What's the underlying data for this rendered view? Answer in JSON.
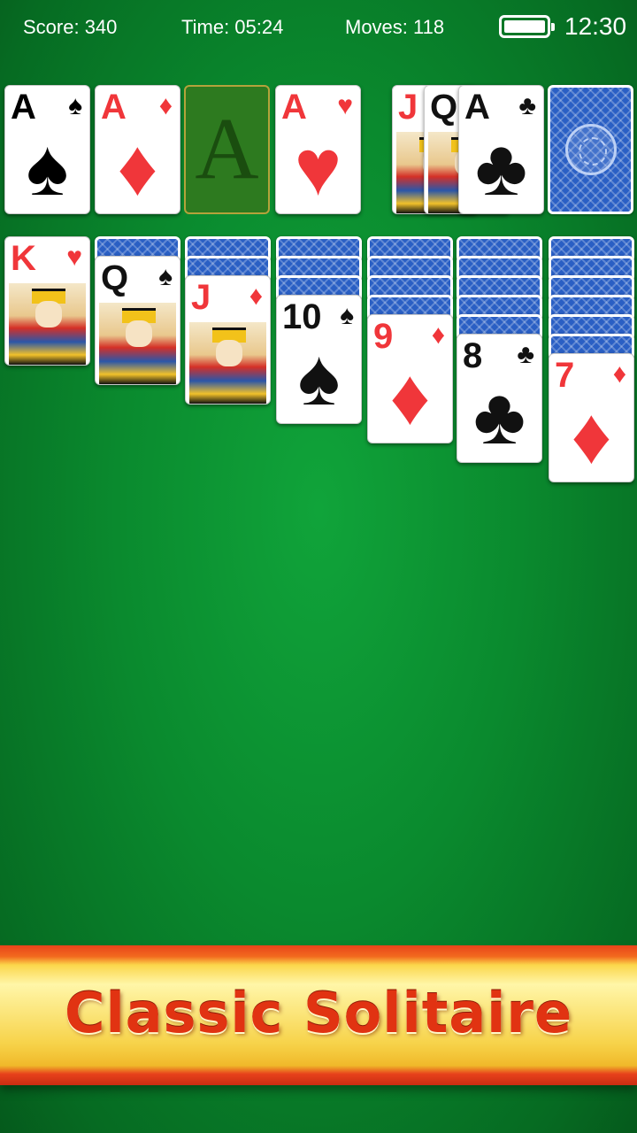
{
  "status": {
    "score": "Score: 340",
    "time": "Time: 05:24",
    "moves": "Moves: 118",
    "clock": "12:30",
    "battery_level": 1.0
  },
  "foundations": [
    {
      "rank": "A",
      "suit": "♠",
      "color": "black"
    },
    {
      "rank": "A",
      "suit": "♦",
      "color": "red"
    },
    {
      "placeholder": "A"
    },
    {
      "rank": "A",
      "suit": "♥",
      "color": "red"
    }
  ],
  "waste": [
    {
      "rank": "J",
      "suit": "",
      "color": "red"
    },
    {
      "rank": "Q",
      "suit": "",
      "color": "black"
    },
    {
      "rank": "A",
      "suit": "♣",
      "color": "black"
    }
  ],
  "stock": {
    "face_down": true
  },
  "tableau": [
    {
      "hidden": 0,
      "top": {
        "rank": "K",
        "suit": "♥",
        "color": "red",
        "court": true
      }
    },
    {
      "hidden": 1,
      "top": {
        "rank": "Q",
        "suit": "♠",
        "color": "black",
        "court": true
      }
    },
    {
      "hidden": 2,
      "top": {
        "rank": "J",
        "suit": "♦",
        "color": "red",
        "court": true
      }
    },
    {
      "hidden": 3,
      "top": {
        "rank": "10",
        "suit": "♠",
        "color": "black"
      }
    },
    {
      "hidden": 4,
      "top": {
        "rank": "9",
        "suit": "♦",
        "color": "red"
      }
    },
    {
      "hidden": 5,
      "top": {
        "rank": "8",
        "suit": "♣",
        "color": "black"
      }
    },
    {
      "hidden": 6,
      "top": {
        "rank": "7",
        "suit": "♦",
        "color": "red"
      }
    }
  ],
  "banner": {
    "title": "Classic Solitaire"
  },
  "colors": {
    "felt": "#0a8a2e",
    "red_suit": "#f0363a",
    "card_back": "#2a5fc4",
    "banner_gold": "#f7d34a"
  }
}
